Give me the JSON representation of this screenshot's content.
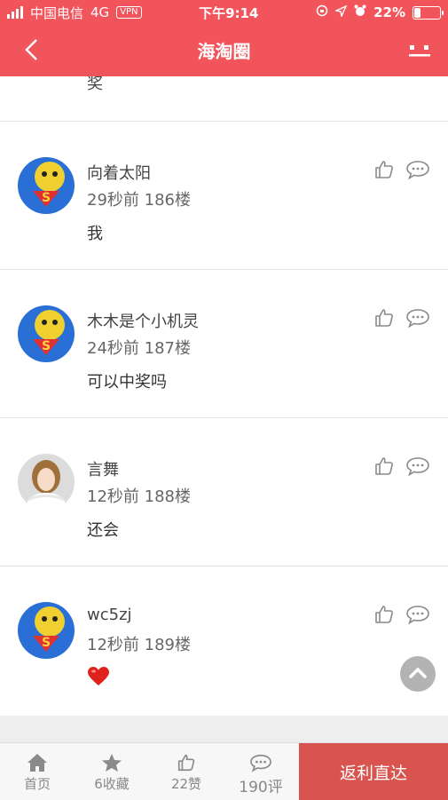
{
  "status_bar": {
    "carrier": "中国电信",
    "network": "4G",
    "vpn": "VPN",
    "time": "下午9:14",
    "battery_percent": "22%",
    "battery_level": 0.22
  },
  "header": {
    "title": "海淘圈"
  },
  "partial_comment_text": "奖",
  "comments": [
    {
      "name": "向着太阳",
      "meta": "29秒前 186楼",
      "text": "我"
    },
    {
      "name": "木木是个小机灵",
      "meta": "24秒前 187楼",
      "text": "可以中奖吗"
    },
    {
      "name": "言舞",
      "meta": "12秒前 188楼",
      "text": "还会"
    },
    {
      "name": "wc5zj",
      "meta": "12秒前 189楼",
      "text": ""
    }
  ],
  "bottom_bar": {
    "home": "首页",
    "favorites": "6收藏",
    "likes": "22赞",
    "comments": "190评",
    "rebate": "返利直达"
  },
  "colors": {
    "brand": "#f2545b",
    "rebate": "#d9534f",
    "icon_gray": "#8a8a8a"
  }
}
